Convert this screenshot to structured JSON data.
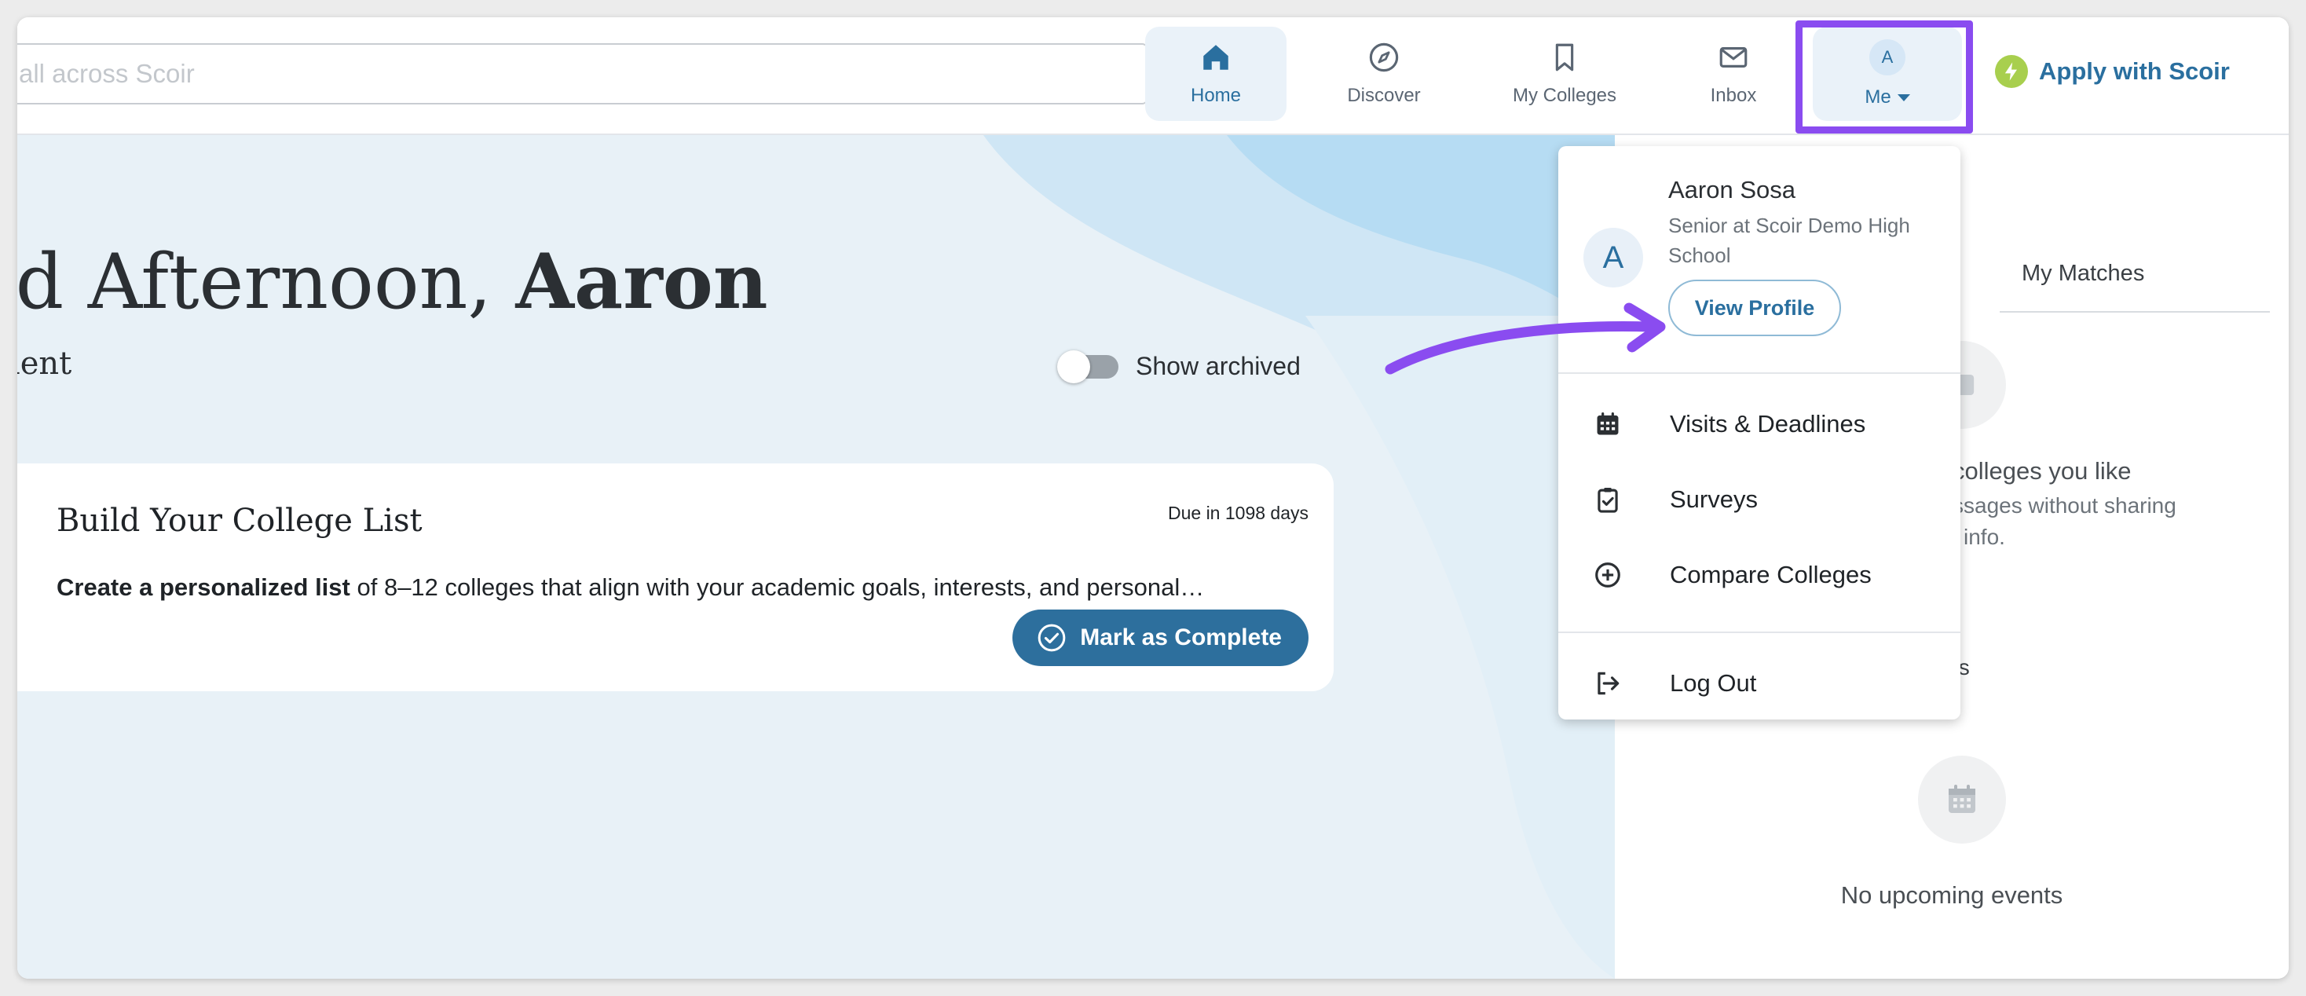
{
  "search": {
    "placeholder": "all across Scoir"
  },
  "nav": {
    "home": "Home",
    "discover": "Discover",
    "my_colleges": "My Colleges",
    "inbox": "Inbox",
    "me": "Me",
    "me_initial": "A"
  },
  "apply": {
    "label": "Apply with Scoir"
  },
  "main": {
    "greeting_prefix": "od Afternoon, ",
    "greeting_name": "Aaron",
    "subhead": "nment",
    "show_archived": "Show archived",
    "card": {
      "title": "Build Your College List",
      "due": "Due in 1098 days",
      "desc_bold": "Create a personalized list",
      "desc_rest": " of 8–12 colleges that align with your academic goals, interests, and personal…",
      "mark_complete": "Mark as Complete"
    }
  },
  "right_panel": {
    "tab": "My Matches",
    "like_text": "colleges you like",
    "like_sub1": "ssages without sharing",
    "like_sub2": "l info.",
    "like_sub3": "ts",
    "no_events": "No upcoming events"
  },
  "dropdown": {
    "initial": "A",
    "name": "Aaron Sosa",
    "role": "Senior at Scoir Demo High School",
    "view_profile": "View Profile",
    "items": [
      {
        "label": "Visits & Deadlines",
        "icon": "calendar-icon"
      },
      {
        "label": "Surveys",
        "icon": "clipboard-check-icon"
      },
      {
        "label": "Compare Colleges",
        "icon": "plus-circle-icon"
      },
      {
        "label": "Log Out",
        "icon": "logout-icon"
      }
    ]
  },
  "colors": {
    "accent": "#2a6f9f",
    "highlight": "#8a4cf0",
    "apply_bolt": "#a8cf4e"
  }
}
